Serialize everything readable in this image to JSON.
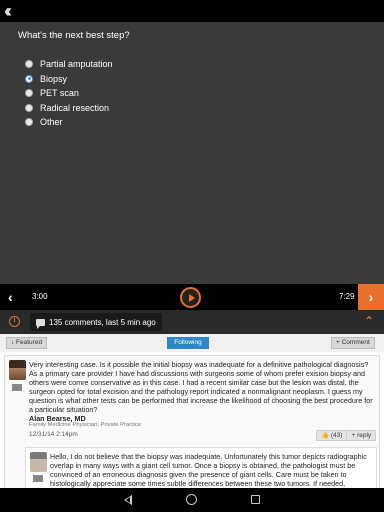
{
  "quiz": {
    "question": "What's the next best step?",
    "options": [
      "Partial amputation",
      "Biopsy",
      "PET scan",
      "Radical resection",
      "Other"
    ],
    "selected": "Biopsy"
  },
  "player": {
    "current_time": "3:00",
    "end_time": "7:29"
  },
  "comments_header": {
    "summary": "135 comments, last 5 min ago"
  },
  "toolbar": {
    "featured_label": "↓ Featured",
    "following_label": "Following",
    "comment_label": "+ Comment"
  },
  "comments": [
    {
      "text": "Very interesting case. Is it possible the initial biopsy was inadequate for a definitive pathological diagnosis? As a primary care provider I have had discussions with surgeons some of whom prefer exision biopsy and others were comre conservative as in this case. I had a recent similar case but the lesion was distal, the surgeon opted for total excision and the pathology report indicated a nonmalignant neoplasm. I guess my question is what other tests can be performed that increase the likelihood of choosing the best procedure for a particular situation?",
      "author": "Alan Bearse, MD",
      "role": "Family Medicine Physician, Private Practice",
      "date": "12/31/14 2:14pm",
      "likes": "(43)",
      "reply_label": "+ reply"
    },
    {
      "text": "Hello, I do not believe that the biopsy was inadequate. Unfortunately this tumor depicts radiographic overlap in many ways with a giant cell tumor. Once a biopsy is obtained, the pathologist must be convinced of an erroneous diagnosis given the presence of giant cells. Care must be taken to histologically appreciate some times subtle differences between these two tumors. If needed, outsourcing the sample to a specialist in the field may be warranted. I am not aware of any special test to improve the differential"
    }
  ],
  "colors": {
    "accent": "#e8702a",
    "following": "#2e87c7",
    "quiz_bg": "#3a3a3a"
  }
}
